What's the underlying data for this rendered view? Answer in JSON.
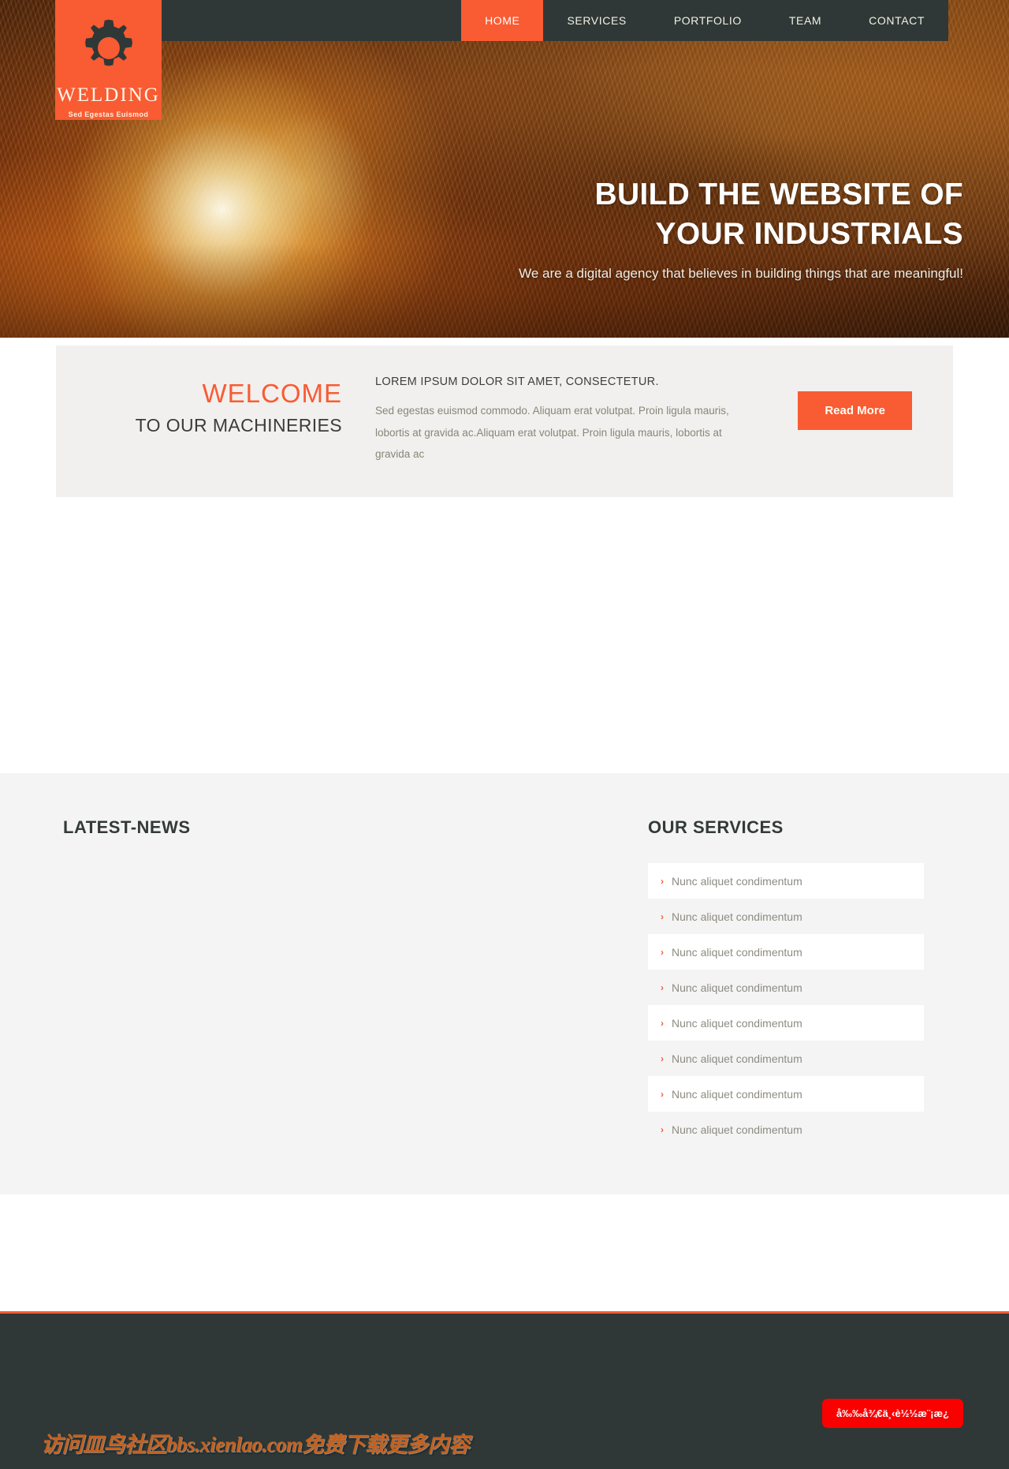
{
  "logo": {
    "icon": "gear-icon",
    "name": "WELDING",
    "tagline": "Sed Egestas Euismod",
    "bg_color": "#f95b33"
  },
  "nav": {
    "active_index": 0,
    "items": [
      {
        "label": "HOME"
      },
      {
        "label": "SERVICES"
      },
      {
        "label": "PORTFOLIO"
      },
      {
        "label": "TEAM"
      },
      {
        "label": "CONTACT"
      }
    ]
  },
  "hero": {
    "title_line1": "BUILD THE WEBSITE OF",
    "title_line2": "YOUR INDUSTRIALS",
    "subtitle": "We are a digital agency that believes in building things that are meaningful!"
  },
  "welcome": {
    "title": "WELCOME",
    "subtitle": "TO OUR MACHINERIES",
    "lead": "LOREM IPSUM DOLOR SIT AMET, CONSECTETUR.",
    "body": "Sed egestas euismod commodo. Aliquam erat volutpat. Proin ligula mauris, lobortis at gravida ac.Aliquam erat volutpat. Proin ligula mauris, lobortis at gravida ac",
    "button_label": "Read More"
  },
  "news": {
    "heading": "LATEST-NEWS"
  },
  "services": {
    "heading": "OUR SERVICES",
    "arrow_glyph": "›",
    "items": [
      {
        "label": "Nunc aliquet condimentum"
      },
      {
        "label": "Nunc aliquet condimentum"
      },
      {
        "label": "Nunc aliquet condimentum"
      },
      {
        "label": "Nunc aliquet condimentum"
      },
      {
        "label": "Nunc aliquet condimentum"
      },
      {
        "label": "Nunc aliquet condimentum"
      },
      {
        "label": "Nunc aliquet condimentum"
      },
      {
        "label": "Nunc aliquet condimentum"
      }
    ]
  },
  "footer": {
    "watermark": "访问皿鸟社区bbs.xienlao.com免费下载更多内容",
    "badge_label": "å‰‰å¾€ä¸‹è½½æ¨¡æ¿",
    "accent_color": "#f95b33",
    "bg_color": "#2f3836"
  }
}
